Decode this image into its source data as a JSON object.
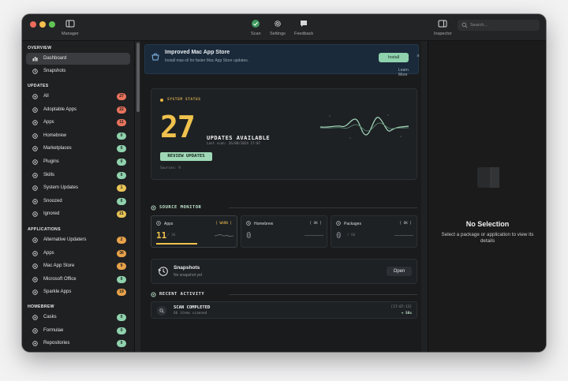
{
  "toolbar": {
    "manager_label": "Manager",
    "scan_label": "Scan",
    "settings_label": "Settings",
    "feedback_label": "Feedback",
    "inspector_label": "Inspector",
    "search_placeholder": "Search..."
  },
  "sidebar": {
    "sections": [
      {
        "title": "OVERVIEW"
      },
      {
        "title": "UPDATES"
      },
      {
        "title": "APPLICATIONS"
      },
      {
        "title": "HOMEBREW"
      }
    ],
    "overview": [
      {
        "label": "Dashboard",
        "icon": "chart-bars-icon"
      },
      {
        "label": "Snapshots",
        "icon": "clock-icon"
      }
    ],
    "updates": [
      {
        "label": "All",
        "badge": "27",
        "color": "#e8735c"
      },
      {
        "label": "Adoptable Apps",
        "badge": "22",
        "color": "#e8735c"
      },
      {
        "label": "Apps",
        "badge": "11",
        "color": "#e8735c"
      },
      {
        "label": "Homebrew",
        "badge": "0",
        "color": "#8fd2ad"
      },
      {
        "label": "Marketplaces",
        "badge": "0",
        "color": "#8fd2ad"
      },
      {
        "label": "Plugins",
        "badge": "0",
        "color": "#8fd2ad"
      },
      {
        "label": "Skills",
        "badge": "0",
        "color": "#8fd2ad"
      },
      {
        "label": "System Updates",
        "badge": "1",
        "color": "#e8c457"
      },
      {
        "label": "Snoozed",
        "badge": "0",
        "color": "#8fd2ad"
      },
      {
        "label": "Ignored",
        "badge": "21",
        "color": "#e8c457"
      }
    ],
    "applications": [
      {
        "label": "Alternative Updaters",
        "badge": "2",
        "color": "#e8a24a"
      },
      {
        "label": "Apps",
        "badge": "36",
        "color": "#e8a24a"
      },
      {
        "label": "Mac App Store",
        "badge": "9",
        "color": "#e8a24a"
      },
      {
        "label": "Microsoft Office",
        "badge": "0",
        "color": "#8fd2ad"
      },
      {
        "label": "Sparkle Apps",
        "badge": "19",
        "color": "#e8a24a"
      }
    ],
    "homebrew": [
      {
        "label": "Casks",
        "badge": "0",
        "color": "#8fd2ad"
      },
      {
        "label": "Formulae",
        "badge": "0",
        "color": "#8fd2ad"
      },
      {
        "label": "Repositories",
        "badge": "0",
        "color": "#8fd2ad"
      }
    ]
  },
  "banner": {
    "title": "Improved Mac App Store",
    "subtitle": "Install mas-cli for faster Mac App Store updates.",
    "install_label": "Install",
    "close_label": "×",
    "learn_more": "Learn More"
  },
  "status": {
    "label": "SYSTEM STATUS",
    "count": "27",
    "updates_available": "UPDATES AVAILABLE",
    "last_scan": "Last scan: 26/08/2024 17:07",
    "review_label": "REVIEW UPDATES",
    "sources": "Sources: 9"
  },
  "source_monitor": {
    "title": "SOURCE MONITOR",
    "cards": [
      {
        "name": "Apps",
        "tag": "[ WARN ]",
        "value": "11",
        "of": "/ 36"
      },
      {
        "name": "Homebrew",
        "tag": "[ OK ]",
        "value": "0",
        "of": ""
      },
      {
        "name": "Packages",
        "tag": "[ OK ]",
        "value": "0",
        "of": "/ 66"
      }
    ]
  },
  "snapshots": {
    "title": "Snapshots",
    "subtitle": "No snapshot yet",
    "open_label": "Open"
  },
  "activity": {
    "title": "RECENT ACTIVITY",
    "items": [
      {
        "title": "SCAN COMPLETED",
        "sub": "66 items scanned",
        "time": "[17:07:13]",
        "duration": "+ 56s"
      }
    ]
  },
  "inspector": {
    "title": "No Selection",
    "subtitle": "Select a package or application to view its details"
  },
  "colors": {
    "accent_green": "#8fd2ad",
    "accent_yellow": "#f0c24d",
    "badge_red": "#e8735c"
  }
}
